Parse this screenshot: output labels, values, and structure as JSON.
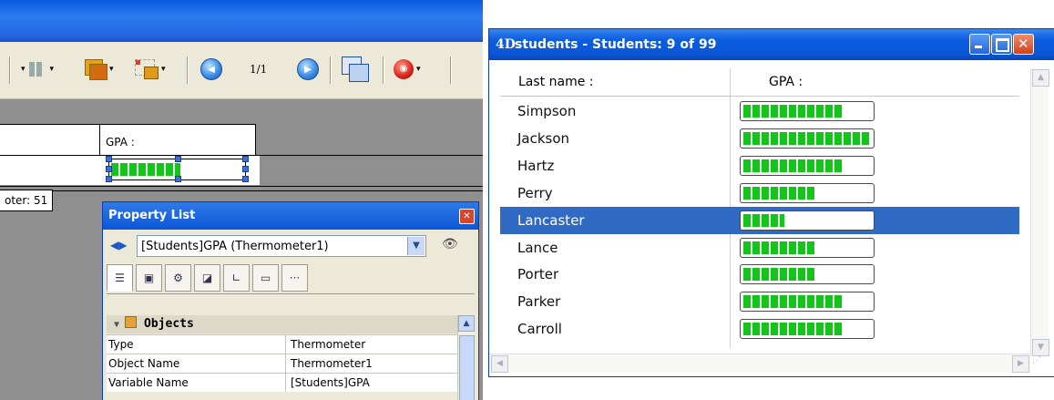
{
  "editor": {
    "toolbar": {
      "page_indicator": "1/1"
    },
    "form": {
      "header_label": "GPA :",
      "footer_marker": "oter: 51"
    },
    "property_list": {
      "title": "Property List",
      "selected_object": "[Students]GPA (Thermometer1)",
      "section_title": "Objects",
      "rows": [
        {
          "key": "Type",
          "value": "Thermometer"
        },
        {
          "key": "Object Name",
          "value": "Thermometer1"
        },
        {
          "key": "Variable Name",
          "value": "[Students]GPA"
        }
      ]
    }
  },
  "students_window": {
    "logo": "4D",
    "title": "students - Students: 9 of 99",
    "columns": [
      "Last name :",
      "GPA :"
    ],
    "rows": [
      {
        "name": "Simpson",
        "gpa_fraction": 0.78
      },
      {
        "name": "Jackson",
        "gpa_fraction": 0.99
      },
      {
        "name": "Hartz",
        "gpa_fraction": 0.78
      },
      {
        "name": "Perry",
        "gpa_fraction": 0.56
      },
      {
        "name": "Lancaster",
        "gpa_fraction": 0.32,
        "selected": true
      },
      {
        "name": "Lance",
        "gpa_fraction": 0.56
      },
      {
        "name": "Porter",
        "gpa_fraction": 0.56
      },
      {
        "name": "Parker",
        "gpa_fraction": 0.78
      },
      {
        "name": "Carroll",
        "gpa_fraction": 0.78
      }
    ]
  },
  "colors": {
    "xp_title_blue": "#0b56d6",
    "selection_blue": "#316ac5",
    "thermometer_green": "#15c41a"
  },
  "icons": [
    "arrow-left-right-icon",
    "eye-icon",
    "objects-cube-icon",
    "previous-page-icon",
    "next-page-icon",
    "stop-icon"
  ]
}
